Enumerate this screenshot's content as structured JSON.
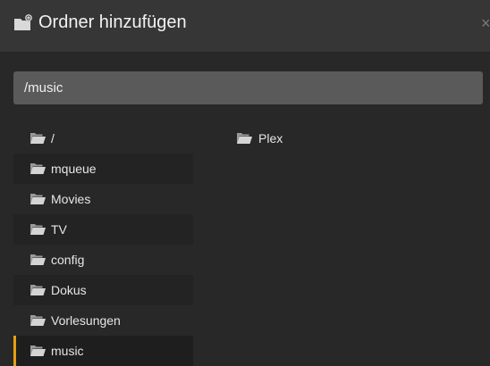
{
  "dialog": {
    "title": "Ordner hinzufügen",
    "close_symbol": "×",
    "icon": "folder-add-icon"
  },
  "path_input": {
    "value": "/music"
  },
  "directories": [
    {
      "label": "/"
    },
    {
      "label": "mqueue"
    },
    {
      "label": "Movies"
    },
    {
      "label": "TV"
    },
    {
      "label": "config"
    },
    {
      "label": "Dokus"
    },
    {
      "label": "Vorlesungen"
    },
    {
      "label": "music",
      "selected": true
    }
  ],
  "subdirectories": [
    {
      "label": "Plex"
    }
  ],
  "colors": {
    "accent": "#e5a00d",
    "background": "#282828",
    "header": "#363636"
  }
}
